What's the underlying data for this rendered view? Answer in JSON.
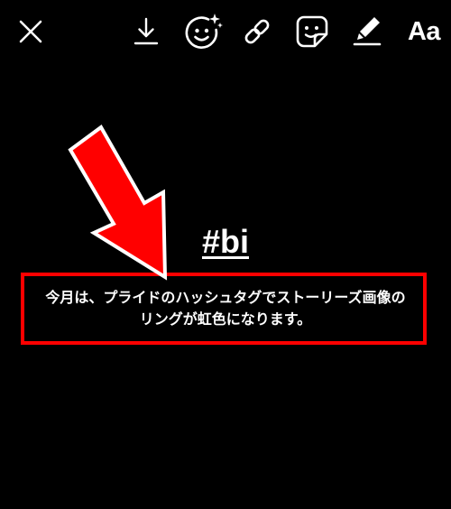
{
  "toolbar": {
    "buttons": [
      {
        "id": "close",
        "icon": "close-icon"
      },
      {
        "id": "download",
        "icon": "download-icon"
      },
      {
        "id": "face-effects",
        "icon": "face-effects-icon"
      },
      {
        "id": "link",
        "icon": "link-icon"
      },
      {
        "id": "sticker",
        "icon": "sticker-icon"
      },
      {
        "id": "draw",
        "icon": "pen-icon"
      },
      {
        "id": "text",
        "icon": "text-icon"
      }
    ],
    "text_button_label": "Aa"
  },
  "story": {
    "hashtag": "#bi",
    "caption": "今月は、プライドのハッシュタグでストーリーズ画像のリングが虹色になります。"
  },
  "annotation": {
    "highlight_color": "#ff0000",
    "arrow_color": "#ff0000",
    "arrow_outline_color": "#ffffff"
  }
}
